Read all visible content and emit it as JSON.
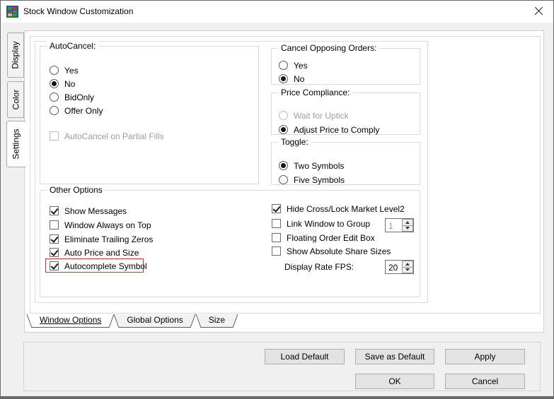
{
  "window": {
    "title": "Stock Window Customization",
    "close_icon": "close-x"
  },
  "side_tabs": [
    {
      "label": "Display",
      "active": false
    },
    {
      "label": "Color",
      "active": false
    },
    {
      "label": "Settings",
      "active": true
    }
  ],
  "groups": {
    "autocancel": {
      "title": "AutoCancel:",
      "radios": [
        {
          "label": "Yes",
          "selected": false
        },
        {
          "label": "No",
          "selected": true
        },
        {
          "label": "BidOnly",
          "selected": false
        },
        {
          "label": "Offer Only",
          "selected": false
        }
      ],
      "partial_fills_checkbox": {
        "label": "AutoCancel on Partial Fills",
        "checked": false,
        "disabled": true
      }
    },
    "cancel_opposing": {
      "title": "Cancel Opposing Orders:",
      "radios": [
        {
          "label": "Yes",
          "selected": false
        },
        {
          "label": "No",
          "selected": true
        }
      ]
    },
    "price_compliance": {
      "title": "Price Compliance:",
      "radios": [
        {
          "label": "Wait for Uptick",
          "selected": false,
          "disabled": true
        },
        {
          "label": "Adjust Price to Comply",
          "selected": true
        }
      ]
    },
    "toggle": {
      "title": "Toggle:",
      "radios": [
        {
          "label": "Two Symbols",
          "selected": true
        },
        {
          "label": "Five Symbols",
          "selected": false
        }
      ]
    },
    "other_options": {
      "title": "Other Options",
      "left_checkboxes": [
        {
          "label": "Show Messages",
          "checked": true,
          "highlighted": false
        },
        {
          "label": "Window Always on Top",
          "checked": false,
          "highlighted": false
        },
        {
          "label": "Eliminate Trailing Zeros",
          "checked": true,
          "highlighted": false
        },
        {
          "label": "Auto Price and Size",
          "checked": true,
          "highlighted": false
        },
        {
          "label": "Autocomplete Symbol",
          "checked": true,
          "highlighted": true
        }
      ],
      "right_checkboxes": [
        {
          "label": "Hide Cross/Lock Market Level2",
          "checked": true
        },
        {
          "label": "Link Window to Group",
          "checked": false
        },
        {
          "label": "Floating Order Edit Box",
          "checked": false
        },
        {
          "label": "Show Absolute Share Sizes",
          "checked": false
        }
      ],
      "link_spinner": {
        "value": "1",
        "disabled": true
      },
      "fps_label": "Display Rate FPS:",
      "fps_spinner": {
        "value": "20",
        "disabled": false
      }
    }
  },
  "bottom_tabs": [
    {
      "label": "Window Options",
      "active": true
    },
    {
      "label": "Global Options",
      "active": false
    },
    {
      "label": "Size",
      "active": false
    }
  ],
  "buttons": {
    "load_default": "Load Default",
    "save_as_default": "Save as Default",
    "apply": "Apply",
    "ok": "OK",
    "cancel": "Cancel"
  },
  "colors": {
    "highlight_red": "#c83434",
    "icon_cells": [
      "#2f9e2f",
      "#cc3333",
      "#cc3333",
      "#2f9e2f",
      "#d9c23a",
      "#2f9e2f"
    ]
  }
}
